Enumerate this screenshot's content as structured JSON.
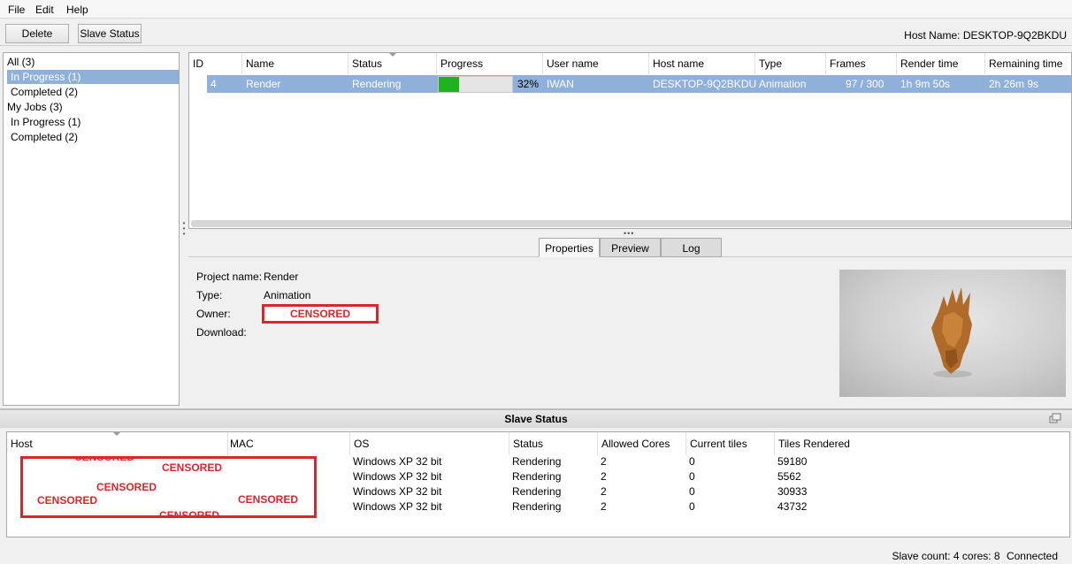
{
  "menu": {
    "file": "File",
    "edit": "Edit",
    "help": "Help"
  },
  "toolbar": {
    "delete_label": "Delete",
    "slave_status_label": "Slave Status",
    "host_name": "Host Name: DESKTOP-9Q2BKDU"
  },
  "tree": {
    "all": "All (3)",
    "all_in_progress": "In Progress (1)",
    "all_completed": "Completed (2)",
    "my_jobs": "My Jobs (3)",
    "my_in_progress": "In Progress (1)",
    "my_completed": "Completed (2)"
  },
  "jobs": {
    "columns": [
      "ID",
      "Name",
      "Status",
      "Progress",
      "User name",
      "Host name",
      "Type",
      "Frames",
      "Render time",
      "Remaining time"
    ],
    "rows": [
      {
        "id": "4",
        "name": "Render",
        "status": "Rendering",
        "progress": 0.28,
        "progress_text": "32%",
        "user": "IWAN",
        "host": "DESKTOP-9Q2BKDU",
        "type": "Animation",
        "frames": "97 / 300",
        "render_time": "1h 9m 50s",
        "remaining_time": "2h 26m 9s"
      }
    ]
  },
  "tabs": {
    "properties": "Properties",
    "preview": "Preview",
    "log": "Log"
  },
  "properties": {
    "project_name_label": "Project name:",
    "project_name": "Render",
    "type_label": "Type:",
    "type": "Animation",
    "owner_label": "Owner:",
    "owner": "CENSORED",
    "download_label": "Download:"
  },
  "slave_status": {
    "title": "Slave Status",
    "columns": [
      "Host",
      "MAC",
      "OS",
      "Status",
      "Allowed Cores",
      "Current tiles",
      "Tiles Rendered"
    ],
    "rows": [
      {
        "os": "Windows XP 32 bit",
        "status": "Rendering",
        "cores": "2",
        "tiles": "0",
        "rendered": "59180"
      },
      {
        "os": "Windows XP 32 bit",
        "status": "Rendering",
        "cores": "2",
        "tiles": "0",
        "rendered": "5562"
      },
      {
        "os": "Windows XP 32 bit",
        "status": "Rendering",
        "cores": "2",
        "tiles": "0",
        "rendered": "30933"
      },
      {
        "os": "Windows XP 32 bit",
        "status": "Rendering",
        "cores": "2",
        "tiles": "0",
        "rendered": "43732"
      }
    ],
    "censored": [
      "CENSORED",
      "CENSORED",
      "CENSORED",
      "CENSORED",
      "CENSORED",
      "CENSORED"
    ]
  },
  "status": {
    "slave_count": "Slave count: 4",
    "cores": "cores: 8",
    "connection": "Connected"
  },
  "colors": {
    "selection": "#8fb0d9",
    "progress": "#1db41d",
    "censor": "#d7262c"
  }
}
